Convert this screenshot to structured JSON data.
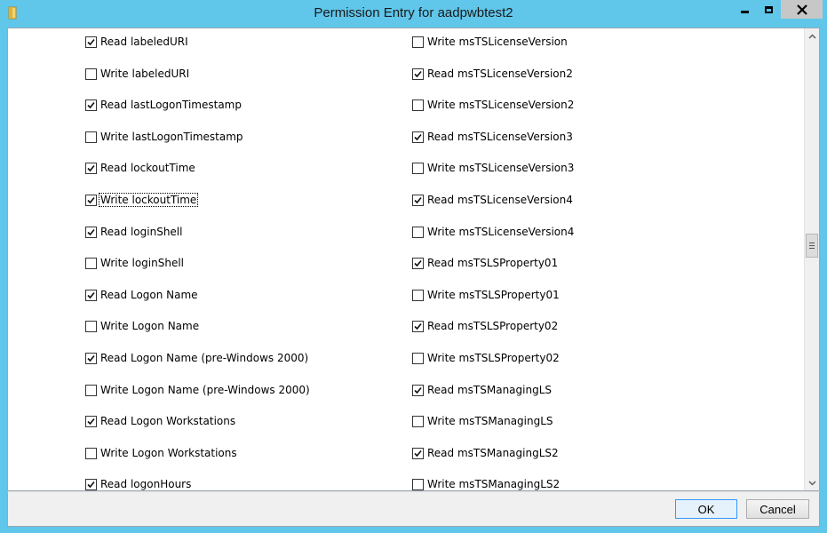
{
  "window": {
    "title": "Permission Entry for aadpwbtest2",
    "frame_color": "#60c6ea"
  },
  "titlebar_buttons": {
    "minimize_icon": "minimize-icon",
    "maximize_icon": "maximize-icon",
    "close_icon": "close-icon"
  },
  "permissions_left": [
    {
      "label": "Read labeledURI",
      "checked": true
    },
    {
      "label": "Write labeledURI",
      "checked": false
    },
    {
      "label": "Read lastLogonTimestamp",
      "checked": true
    },
    {
      "label": "Write lastLogonTimestamp",
      "checked": false
    },
    {
      "label": "Read lockoutTime",
      "checked": true
    },
    {
      "label": "Write lockoutTime",
      "checked": true,
      "focused": true
    },
    {
      "label": "Read loginShell",
      "checked": true
    },
    {
      "label": "Write loginShell",
      "checked": false
    },
    {
      "label": "Read Logon Name",
      "checked": true
    },
    {
      "label": "Write Logon Name",
      "checked": false
    },
    {
      "label": "Read Logon Name (pre-Windows 2000)",
      "checked": true
    },
    {
      "label": "Write Logon Name (pre-Windows 2000)",
      "checked": false
    },
    {
      "label": "Read Logon Workstations",
      "checked": true
    },
    {
      "label": "Write Logon Workstations",
      "checked": false
    },
    {
      "label": "Read logonHours",
      "checked": true
    }
  ],
  "permissions_right": [
    {
      "label": "Write msTSLicenseVersion",
      "checked": false
    },
    {
      "label": "Read msTSLicenseVersion2",
      "checked": true
    },
    {
      "label": "Write msTSLicenseVersion2",
      "checked": false
    },
    {
      "label": "Read msTSLicenseVersion3",
      "checked": true
    },
    {
      "label": "Write msTSLicenseVersion3",
      "checked": false
    },
    {
      "label": "Read msTSLicenseVersion4",
      "checked": true
    },
    {
      "label": "Write msTSLicenseVersion4",
      "checked": false
    },
    {
      "label": "Read msTSLSProperty01",
      "checked": true
    },
    {
      "label": "Write msTSLSProperty01",
      "checked": false
    },
    {
      "label": "Read msTSLSProperty02",
      "checked": true
    },
    {
      "label": "Write msTSLSProperty02",
      "checked": false
    },
    {
      "label": "Read msTSManagingLS",
      "checked": true
    },
    {
      "label": "Write msTSManagingLS",
      "checked": false
    },
    {
      "label": "Read msTSManagingLS2",
      "checked": true
    },
    {
      "label": "Write msTSManagingLS2",
      "checked": false
    }
  ],
  "buttons": {
    "ok_label": "OK",
    "cancel_label": "Cancel"
  }
}
